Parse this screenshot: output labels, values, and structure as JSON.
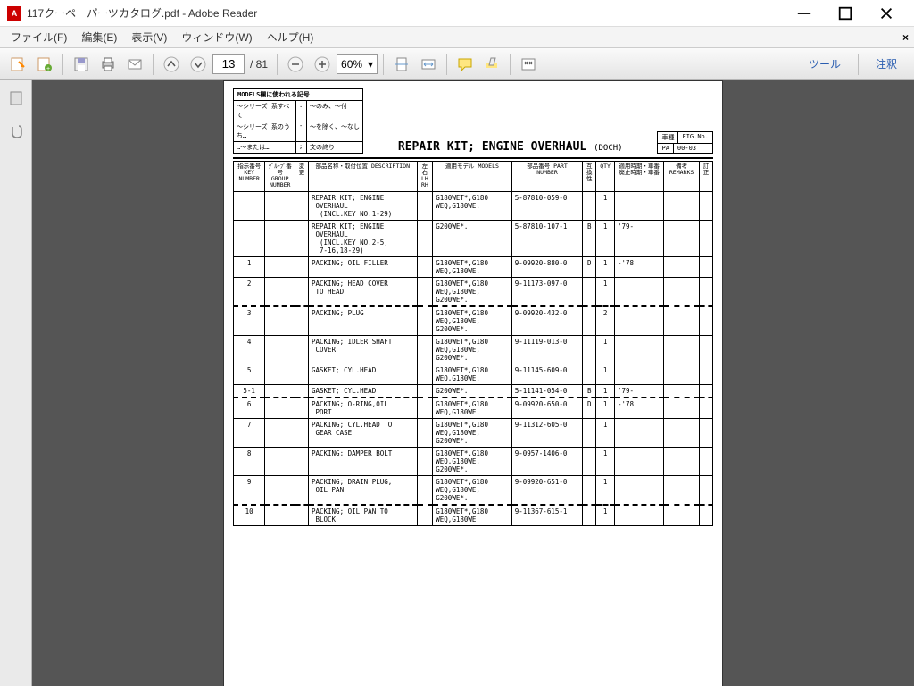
{
  "window": {
    "title": "117クーペ　パーツカタログ.pdf - Adobe Reader"
  },
  "menu": [
    "ファイル(F)",
    "編集(E)",
    "表示(V)",
    "ウィンドウ(W)",
    "ヘルプ(H)"
  ],
  "toolbar": {
    "page_current": "13",
    "page_total": "/ 81",
    "zoom": "60%",
    "tool": "ツール",
    "annotate": "注釈"
  },
  "document": {
    "legend": {
      "title": "MODELS欄に使われる記号",
      "rows": [
        [
          "～シリーズ 系すべて",
          ".",
          "～のみ、～付"
        ],
        [
          "～シリーズ 系のうち…",
          "-",
          "～を除く、～なし"
        ],
        [
          "…～または…",
          ";",
          "文の終り"
        ]
      ]
    },
    "title": "REPAIR KIT; ENGINE OVERHAUL",
    "title_sub": "(DOCH)",
    "figbox": {
      "r1": [
        "車種",
        "FIG.No."
      ],
      "r2": [
        "PA",
        "00-03"
      ]
    },
    "headers": {
      "key": "指示番号\nKEY\nNUMBER",
      "group": "ｸﾞﾙｰﾌﾟ番号\nGROUP\nNUMBER",
      "chg": "変更",
      "desc": "部品名称・取付位置\nDESCRIPTION",
      "lh": "左右\nLH\nRH",
      "models": "適用モデル\nMODELS",
      "part": "部品番号\nPART NUMBER",
      "ic": "互換性",
      "qty": "QTY",
      "period": "適用時期・車番\n廃止時期・車番",
      "remarks": "備考\nREMARKS",
      "fix": "訂正"
    },
    "rows": [
      {
        "key": "",
        "desc": "REPAIR KIT; ENGINE\n OVERHAUL\n  (INCL.KEY NO.1-29)",
        "models": "G180WET*,G180\nWEQ,G180WE.",
        "part": "5-87810-059-0",
        "ic": "",
        "qty": "1",
        "period": "",
        "sep": false
      },
      {
        "key": "",
        "desc": "REPAIR KIT; ENGINE\n OVERHAUL\n  (INCL.KEY NO.2-5,\n  7-16,18-29)",
        "models": "G200WE*.",
        "part": "5-87810-107-1",
        "ic": "B",
        "qty": "1",
        "period": "'79-",
        "sep": false
      },
      {
        "key": "1",
        "desc": "PACKING; OIL FILLER",
        "models": "G180WET*,G180\nWEQ,G180WE.",
        "part": "9-09920-880-0",
        "ic": "D",
        "qty": "1",
        "period": "-'78",
        "sep": false
      },
      {
        "key": "2",
        "desc": "PACKING; HEAD COVER\n TO HEAD",
        "models": "G180WET*,G180\nWEQ,G180WE,\nG200WE*.",
        "part": "9-11173-097-0",
        "ic": "",
        "qty": "1",
        "period": "",
        "sep": false
      },
      {
        "key": "3",
        "desc": "PACKING; PLUG",
        "models": "G180WET*,G180\nWEQ,G180WE,\nG200WE*.",
        "part": "9-09920-432-0",
        "ic": "",
        "qty": "2",
        "period": "",
        "sep": true
      },
      {
        "key": "4",
        "desc": "PACKING; IDLER SHAFT\n COVER",
        "models": "G180WET*,G180\nWEQ,G180WE,\nG200WE*.",
        "part": "9-11119-013-0",
        "ic": "",
        "qty": "1",
        "period": "",
        "sep": false
      },
      {
        "key": "5",
        "desc": "GASKET; CYL.HEAD",
        "models": "G180WET*,G180\nWEQ,G180WE.",
        "part": "9-11145-609-0",
        "ic": "",
        "qty": "1",
        "period": "",
        "sep": false
      },
      {
        "key": "5-1",
        "desc": "GASKET; CYL.HEAD",
        "models": "G200WE*.",
        "part": "5-11141-054-0",
        "ic": "B",
        "qty": "1",
        "period": "'79-",
        "sep": false
      },
      {
        "key": "6",
        "desc": "PACKING; O-RING,OIL\n PORT",
        "models": "G180WET*,G180\nWEQ,G180WE.",
        "part": "9-09920-650-0",
        "ic": "D",
        "qty": "1",
        "period": "-'78",
        "sep": true
      },
      {
        "key": "7",
        "desc": "PACKING; CYL.HEAD TO\n GEAR CASE",
        "models": "G180WET*,G180\nWEQ,G180WE,\nG200WE*.",
        "part": "9-11312-605-0",
        "ic": "",
        "qty": "1",
        "period": "",
        "sep": false
      },
      {
        "key": "8",
        "desc": "PACKING; DAMPER BOLT",
        "models": "G180WET*,G180\nWEQ,G180WE,\nG200WE*.",
        "part": "9-0957-1406-0",
        "ic": "",
        "qty": "1",
        "period": "",
        "sep": false
      },
      {
        "key": "9",
        "desc": "PACKING; DRAIN PLUG,\n OIL PAN",
        "models": "G180WET*,G180\nWEQ,G180WE,\nG200WE*.",
        "part": "9-09920-651-0",
        "ic": "",
        "qty": "1",
        "period": "",
        "sep": false
      },
      {
        "key": "10",
        "desc": "PACKING; OIL PAN TO\n BLOCK",
        "models": "G180WET*,G180\nWEQ,G180WE",
        "part": "9-11367-615-1",
        "ic": "",
        "qty": "1",
        "period": "",
        "sep": true
      }
    ]
  }
}
